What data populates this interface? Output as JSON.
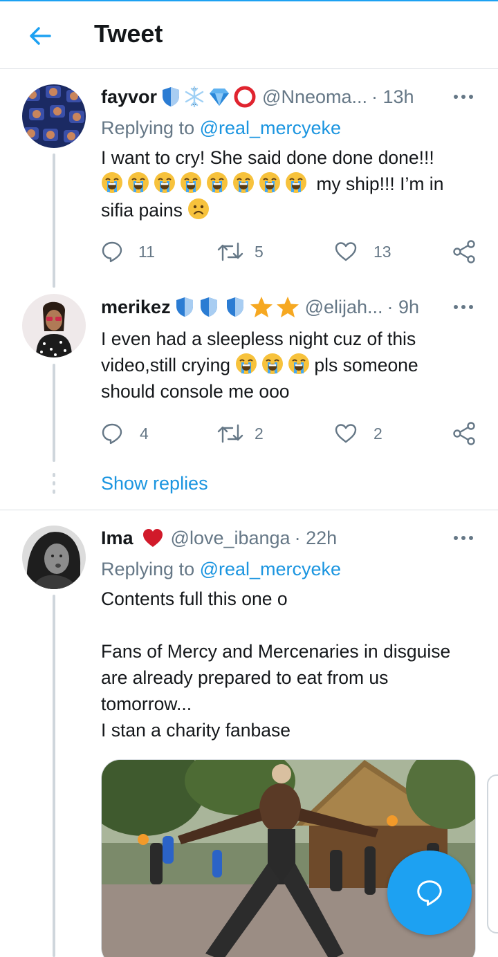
{
  "header": {
    "title": "Tweet"
  },
  "tweets": [
    {
      "name": "fayvor",
      "badges": [
        "shield-icon",
        "snowflake-icon",
        "diamond-icon",
        "ring-icon"
      ],
      "handle": "@Nneoma...",
      "time": "· 13h",
      "reply_prefix": "Replying to ",
      "reply_handle": "@real_mercyeke",
      "lines": [
        "I want to cry! She said done done done!!!",
        " my ship!!! I’m in",
        "sifia pains "
      ],
      "crying_emoji_count": 8,
      "replies": "11",
      "retweets": "5",
      "likes": "13"
    },
    {
      "name": "merikez",
      "badges": [
        "shield-icon",
        "shield-icon",
        "shield-icon",
        "star-icon",
        "star-icon"
      ],
      "handle": "@elijah...",
      "time": "· 9h",
      "lines": [
        "I even had a sleepless night cuz of this",
        "video,still crying ",
        "pls someone",
        "should console me ooo"
      ],
      "replies": "4",
      "retweets": "2",
      "likes": "2"
    },
    {
      "name": "Ima",
      "badges": [
        "heart-icon"
      ],
      "handle": "@love_ibanga",
      "time": "· 22h",
      "reply_prefix": "Replying to ",
      "reply_handle": "@real_mercyeke",
      "lines": [
        "Contents full this one o",
        "",
        "Fans of Mercy and Mercenaries in disguise",
        "are already prepared to eat from us",
        "tomorrow...",
        "I stan a charity fanbase"
      ]
    }
  ],
  "show_replies": "Show replies",
  "colors": {
    "accent": "#1da1f2",
    "link": "#1b95e0",
    "muted": "#657786"
  }
}
